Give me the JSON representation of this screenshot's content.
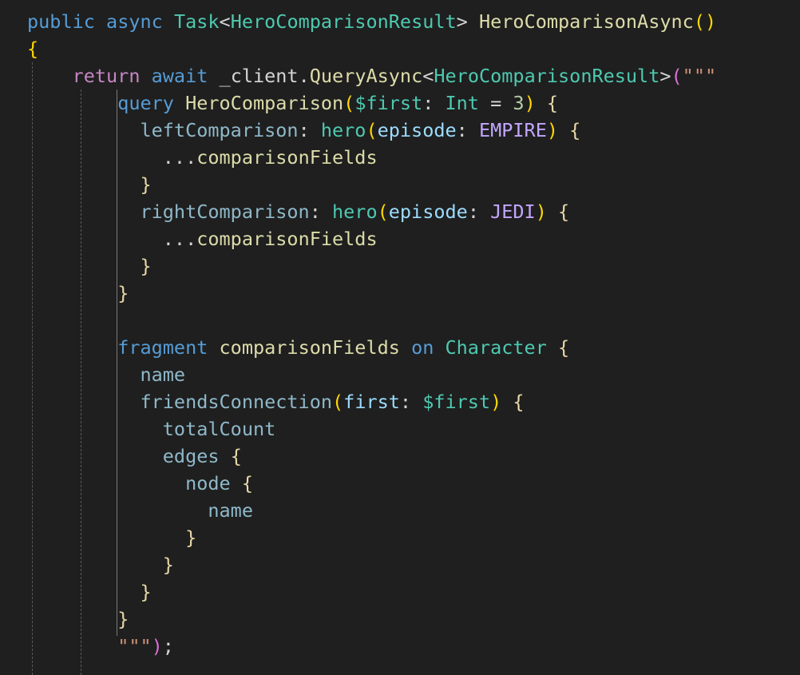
{
  "colors": {
    "background": "#1f1f1f",
    "keyword": "#569cd6",
    "control": "#c586c0",
    "type": "#4ec9b0",
    "method": "#dcdcaa",
    "variable": "#9cdcfe",
    "field": "#8fb8c9",
    "plain": "#d4d4d4",
    "string": "#ce9178",
    "number": "#b5cea8",
    "punct": "#d4d4d4",
    "enum": "#c3a6ff",
    "brace_gold": "#ffd700",
    "brace_purple": "#da70d6",
    "brace_blue": "#179fff",
    "gql_brace": "#e8d8a8"
  },
  "code_lines": [
    [
      {
        "t": "public",
        "c": "keyword"
      },
      {
        "t": " "
      },
      {
        "t": "async",
        "c": "keyword"
      },
      {
        "t": " "
      },
      {
        "t": "Task",
        "c": "type"
      },
      {
        "t": "<",
        "c": "plain"
      },
      {
        "t": "HeroComparisonResult",
        "c": "type"
      },
      {
        "t": ">",
        "c": "plain"
      },
      {
        "t": " "
      },
      {
        "t": "HeroComparisonAsync",
        "c": "method"
      },
      {
        "t": "()",
        "c": "brace_gold"
      }
    ],
    [
      {
        "t": "{",
        "c": "brace_gold"
      }
    ],
    [
      {
        "t": "    "
      },
      {
        "t": "return",
        "c": "control"
      },
      {
        "t": " "
      },
      {
        "t": "await",
        "c": "keyword"
      },
      {
        "t": " "
      },
      {
        "t": "_client",
        "c": "plain"
      },
      {
        "t": ".",
        "c": "plain"
      },
      {
        "t": "QueryAsync",
        "c": "method"
      },
      {
        "t": "<",
        "c": "plain"
      },
      {
        "t": "HeroComparisonResult",
        "c": "type"
      },
      {
        "t": ">",
        "c": "plain"
      },
      {
        "t": "(",
        "c": "brace_purple"
      },
      {
        "t": "\"\"\"",
        "c": "string"
      }
    ],
    [
      {
        "t": "        "
      },
      {
        "t": "query",
        "c": "keyword"
      },
      {
        "t": " "
      },
      {
        "t": "HeroComparison",
        "c": "method"
      },
      {
        "t": "(",
        "c": "brace_gold"
      },
      {
        "t": "$first",
        "c": "type"
      },
      {
        "t": ": ",
        "c": "plain"
      },
      {
        "t": "Int",
        "c": "type"
      },
      {
        "t": " = ",
        "c": "plain"
      },
      {
        "t": "3",
        "c": "number"
      },
      {
        "t": ")",
        "c": "brace_gold"
      },
      {
        "t": " "
      },
      {
        "t": "{",
        "c": "gql_brace"
      }
    ],
    [
      {
        "t": "          "
      },
      {
        "t": "leftComparison",
        "c": "field"
      },
      {
        "t": ": ",
        "c": "plain"
      },
      {
        "t": "hero",
        "c": "type"
      },
      {
        "t": "(",
        "c": "brace_gold"
      },
      {
        "t": "episode",
        "c": "variable"
      },
      {
        "t": ": ",
        "c": "plain"
      },
      {
        "t": "EMPIRE",
        "c": "enum"
      },
      {
        "t": ")",
        "c": "brace_gold"
      },
      {
        "t": " "
      },
      {
        "t": "{",
        "c": "gql_brace"
      }
    ],
    [
      {
        "t": "            "
      },
      {
        "t": "...",
        "c": "plain"
      },
      {
        "t": "comparisonFields",
        "c": "method"
      }
    ],
    [
      {
        "t": "          "
      },
      {
        "t": "}",
        "c": "gql_brace"
      }
    ],
    [
      {
        "t": "          "
      },
      {
        "t": "rightComparison",
        "c": "field"
      },
      {
        "t": ": ",
        "c": "plain"
      },
      {
        "t": "hero",
        "c": "type"
      },
      {
        "t": "(",
        "c": "brace_gold"
      },
      {
        "t": "episode",
        "c": "variable"
      },
      {
        "t": ": ",
        "c": "plain"
      },
      {
        "t": "JEDI",
        "c": "enum"
      },
      {
        "t": ")",
        "c": "brace_gold"
      },
      {
        "t": " "
      },
      {
        "t": "{",
        "c": "gql_brace"
      }
    ],
    [
      {
        "t": "            "
      },
      {
        "t": "...",
        "c": "plain"
      },
      {
        "t": "comparisonFields",
        "c": "method"
      }
    ],
    [
      {
        "t": "          "
      },
      {
        "t": "}",
        "c": "gql_brace"
      }
    ],
    [
      {
        "t": "        "
      },
      {
        "t": "}",
        "c": "gql_brace"
      }
    ],
    [],
    [
      {
        "t": "        "
      },
      {
        "t": "fragment",
        "c": "keyword"
      },
      {
        "t": " "
      },
      {
        "t": "comparisonFields",
        "c": "method"
      },
      {
        "t": " "
      },
      {
        "t": "on",
        "c": "keyword"
      },
      {
        "t": " "
      },
      {
        "t": "Character",
        "c": "type"
      },
      {
        "t": " "
      },
      {
        "t": "{",
        "c": "gql_brace"
      }
    ],
    [
      {
        "t": "          "
      },
      {
        "t": "name",
        "c": "field"
      }
    ],
    [
      {
        "t": "          "
      },
      {
        "t": "friendsConnection",
        "c": "field"
      },
      {
        "t": "(",
        "c": "brace_gold"
      },
      {
        "t": "first",
        "c": "variable"
      },
      {
        "t": ": ",
        "c": "plain"
      },
      {
        "t": "$first",
        "c": "type"
      },
      {
        "t": ")",
        "c": "brace_gold"
      },
      {
        "t": " "
      },
      {
        "t": "{",
        "c": "gql_brace"
      }
    ],
    [
      {
        "t": "            "
      },
      {
        "t": "totalCount",
        "c": "field"
      }
    ],
    [
      {
        "t": "            "
      },
      {
        "t": "edges",
        "c": "field"
      },
      {
        "t": " "
      },
      {
        "t": "{",
        "c": "gql_brace"
      }
    ],
    [
      {
        "t": "              "
      },
      {
        "t": "node",
        "c": "field"
      },
      {
        "t": " "
      },
      {
        "t": "{",
        "c": "gql_brace"
      }
    ],
    [
      {
        "t": "                "
      },
      {
        "t": "name",
        "c": "field"
      }
    ],
    [
      {
        "t": "              "
      },
      {
        "t": "}",
        "c": "gql_brace"
      }
    ],
    [
      {
        "t": "            "
      },
      {
        "t": "}",
        "c": "gql_brace"
      }
    ],
    [
      {
        "t": "          "
      },
      {
        "t": "}",
        "c": "gql_brace"
      }
    ],
    [
      {
        "t": "        "
      },
      {
        "t": "}",
        "c": "gql_brace"
      }
    ],
    [
      {
        "t": "        "
      },
      {
        "t": "\"\"\"",
        "c": "string"
      },
      {
        "t": ")",
        "c": "brace_purple"
      },
      {
        "t": ";",
        "c": "plain"
      }
    ]
  ]
}
